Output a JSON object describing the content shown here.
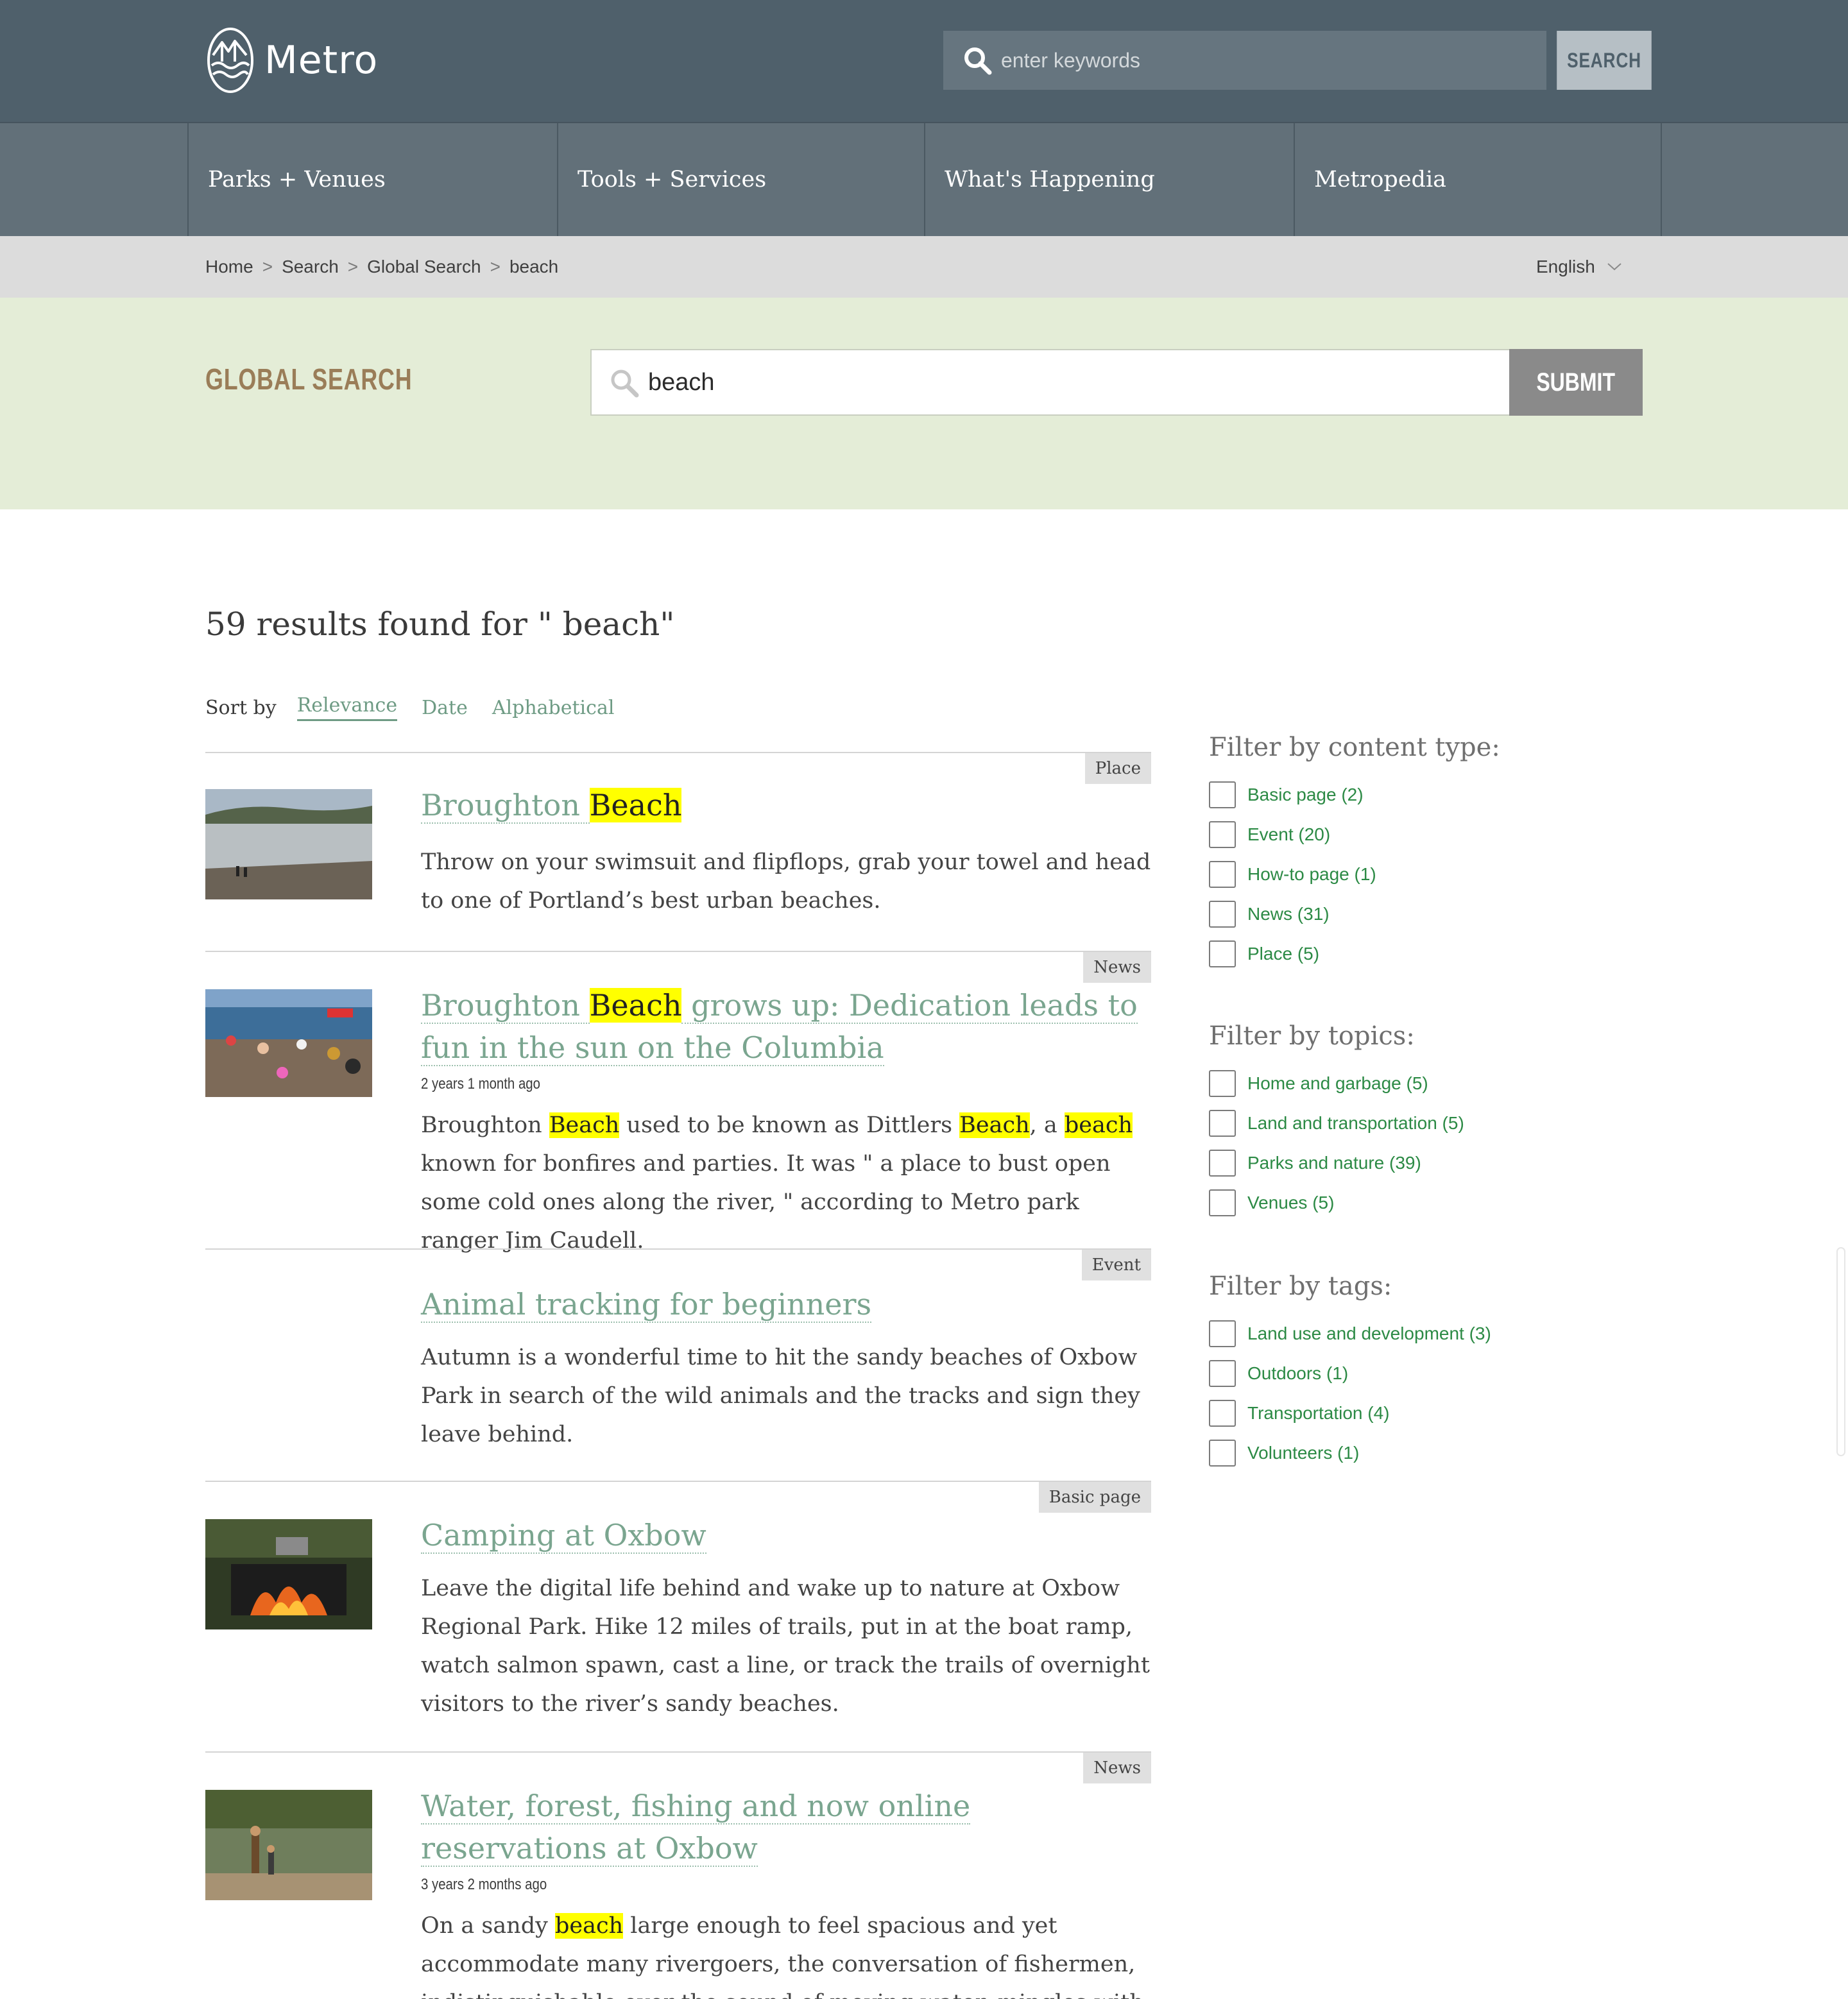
{
  "header": {
    "logo_text": "Metro",
    "search_placeholder": "enter keywords",
    "search_button": "SEARCH"
  },
  "nav": {
    "items": [
      "Parks + Venues",
      "Tools + Services",
      "What's Happening",
      "Metropedia"
    ]
  },
  "breadcrumb": {
    "items": [
      "Home",
      "Search",
      "Global Search",
      "beach"
    ],
    "separator": ">"
  },
  "language": {
    "selected": "English"
  },
  "global_search": {
    "title": "GLOBAL SEARCH",
    "query": "beach",
    "submit_label": "SUBMIT"
  },
  "results_header": {
    "count_text": "59 results found for \" beach\"",
    "sort_label": "Sort by",
    "sort_options": [
      "Relevance",
      "Date",
      "Alphabetical"
    ],
    "sort_active": "Relevance"
  },
  "results": [
    {
      "type": "Place",
      "title_a": "Broughton ",
      "title_hl": "Beach",
      "title_b": "",
      "date": "",
      "desc": "Throw on your swimsuit and flipflops, grab your towel and head to one of Portland’s best urban beaches."
    },
    {
      "type": "News",
      "title_a": "Broughton ",
      "title_hl": "Beach",
      "title_b": " grows up: Dedication leads to fun in the sun on the Columbia",
      "date": "2 years 1 month ago",
      "desc_parts": [
        "Broughton ",
        "Beach",
        " used to be known as Dittlers ",
        "Beach",
        ", a ",
        "beach",
        " known for bonfires and parties. It was \" a place to bust open some cold ones along the river, \"  according to Metro park ranger Jim Caudell."
      ]
    },
    {
      "type": "Event",
      "title": "Animal tracking for beginners",
      "desc": "Autumn is a wonderful time to hit the sandy beaches of Oxbow Park in search of the wild animals and the tracks and sign they leave behind."
    },
    {
      "type": "Basic page",
      "title": "Camping at Oxbow",
      "desc": "Leave the digital life behind and wake up to nature at Oxbow Regional Park. Hike 12 miles of trails, put in at the boat ramp, watch salmon spawn, cast a line, or track the trails of overnight visitors to the river’s sandy beaches."
    },
    {
      "type": "News",
      "title": "Water, forest, fishing and now online reservations at Oxbow",
      "date": "3 years 2 months ago",
      "desc_parts": [
        "On a sandy ",
        "beach",
        " large enough to feel spacious and yet accommodate many rivergoers, the conversation of fishermen, indistinguishable over the sound of moving water, mingles with the arguing voices of"
      ]
    }
  ],
  "filters": {
    "content_type": {
      "heading": "Filter by content type:",
      "options": [
        "Basic page (2)",
        "Event (20)",
        "How-to page (1)",
        "News (31)",
        "Place (5)"
      ]
    },
    "topics": {
      "heading": "Filter by topics:",
      "options": [
        "Home and garbage (5)",
        "Land and transportation (5)",
        "Parks and nature (39)",
        "Venues (5)"
      ]
    },
    "tags": {
      "heading": "Filter by tags:",
      "options": [
        "Land use and development (3)",
        "Outdoors (1)",
        "Transportation (4)",
        "Volunteers (1)"
      ]
    }
  },
  "colors": {
    "header_bg": "#4f606b",
    "nav_bg": "#627079",
    "search_band_bg": "#e4edd7",
    "link_green": "#7aa58f",
    "filter_green": "#2c8a45",
    "highlight": "#ffff00",
    "global_search_title": "#9a7d58"
  }
}
